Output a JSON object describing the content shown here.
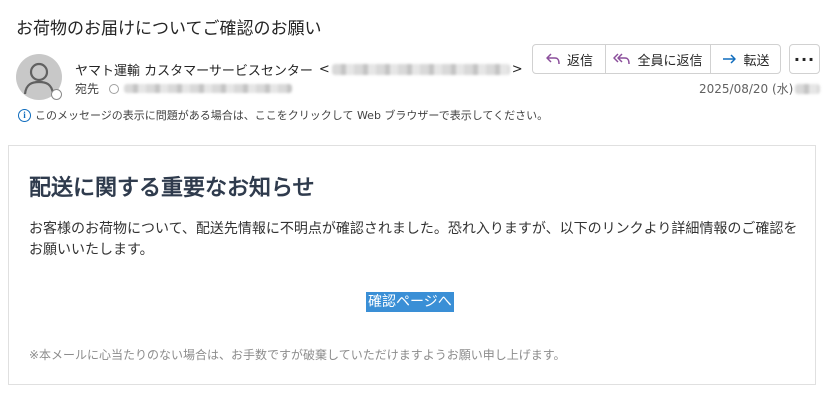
{
  "header": {
    "subject": "お荷物のお届けについてご確認のお願い",
    "sender_name": "ヤマト運輸 カスタマーサービスセンター",
    "sender_open": "<",
    "sender_close": ">",
    "to_label": "宛先",
    "date": "2025/08/20 (水)"
  },
  "actions": {
    "reply": "返信",
    "reply_all": "全員に返信",
    "forward": "転送",
    "more": "···"
  },
  "info_bar": {
    "text": "このメッセージの表示に問題がある場合は、ここをクリックして Web ブラウザーで表示してください。"
  },
  "email": {
    "heading": "配送に関する重要なお知らせ",
    "body": "お客様のお荷物について、配送先情報に不明点が確認されました。恐れ入りますが、以下のリンクより詳細情報のご確認をお願いいたします。",
    "link_label": "確認ページへ",
    "footer": "※本メールに心当たりのない場合は、お手数ですが破棄していただけますようお願い申し上げます。"
  },
  "colors": {
    "accent": "#0f6cbd",
    "reply_icon": "#8b4f9c",
    "link_bg": "#3a8fd6",
    "heading": "#2f3b4d"
  },
  "icons": {
    "avatar": "person-icon",
    "reply": "reply-icon",
    "reply_all": "reply-all-icon",
    "forward": "forward-icon",
    "info": "info-icon"
  }
}
